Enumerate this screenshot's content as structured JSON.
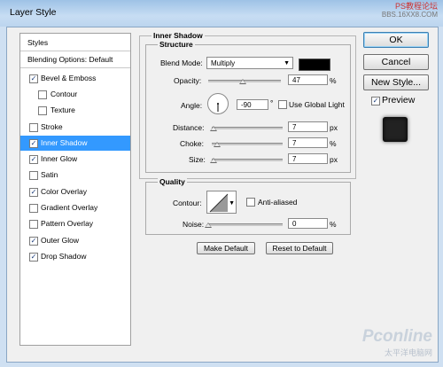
{
  "window": {
    "title": "Layer Style"
  },
  "watermark": {
    "top": "PS教程论坛",
    "url": "BBS.16XX8.COM"
  },
  "styles_list": {
    "header": "Styles",
    "blending": "Blending Options: Default",
    "items": [
      {
        "label": "Bevel & Emboss",
        "checked": "✓"
      },
      {
        "label": "Contour",
        "checked": ""
      },
      {
        "label": "Texture",
        "checked": ""
      },
      {
        "label": "Stroke",
        "checked": ""
      },
      {
        "label": "Inner Shadow",
        "checked": "✓"
      },
      {
        "label": "Inner Glow",
        "checked": "✓"
      },
      {
        "label": "Satin",
        "checked": ""
      },
      {
        "label": "Color Overlay",
        "checked": "✓"
      },
      {
        "label": "Gradient Overlay",
        "checked": ""
      },
      {
        "label": "Pattern Overlay",
        "checked": ""
      },
      {
        "label": "Outer Glow",
        "checked": "✓"
      },
      {
        "label": "Drop Shadow",
        "checked": "✓"
      }
    ]
  },
  "inner_shadow": {
    "section_title": "Inner Shadow",
    "structure_title": "Structure",
    "blend_mode_label": "Blend Mode:",
    "blend_mode_value": "Multiply",
    "blend_color": "#000000",
    "opacity_label": "Opacity:",
    "opacity_value": "47",
    "opacity_unit": "%",
    "angle_label": "Angle:",
    "angle_value": "-90",
    "angle_unit": "°",
    "use_global_light_label": "Use Global Light",
    "use_global_light_checked": "",
    "distance_label": "Distance:",
    "distance_value": "7",
    "distance_unit": "px",
    "choke_label": "Choke:",
    "choke_value": "7",
    "choke_unit": "%",
    "size_label": "Size:",
    "size_value": "7",
    "size_unit": "px"
  },
  "quality": {
    "title": "Quality",
    "contour_label": "Contour:",
    "anti_aliased_label": "Anti-aliased",
    "anti_aliased_checked": "",
    "noise_label": "Noise:",
    "noise_value": "0",
    "noise_unit": "%"
  },
  "buttons": {
    "make_default": "Make Default",
    "reset_default": "Reset to Default",
    "ok": "OK",
    "cancel": "Cancel",
    "new_style": "New Style..."
  },
  "preview": {
    "label": "Preview",
    "checked": "✓"
  },
  "logo": {
    "brand": "Pconline",
    "sub": "太平洋电脑网"
  }
}
